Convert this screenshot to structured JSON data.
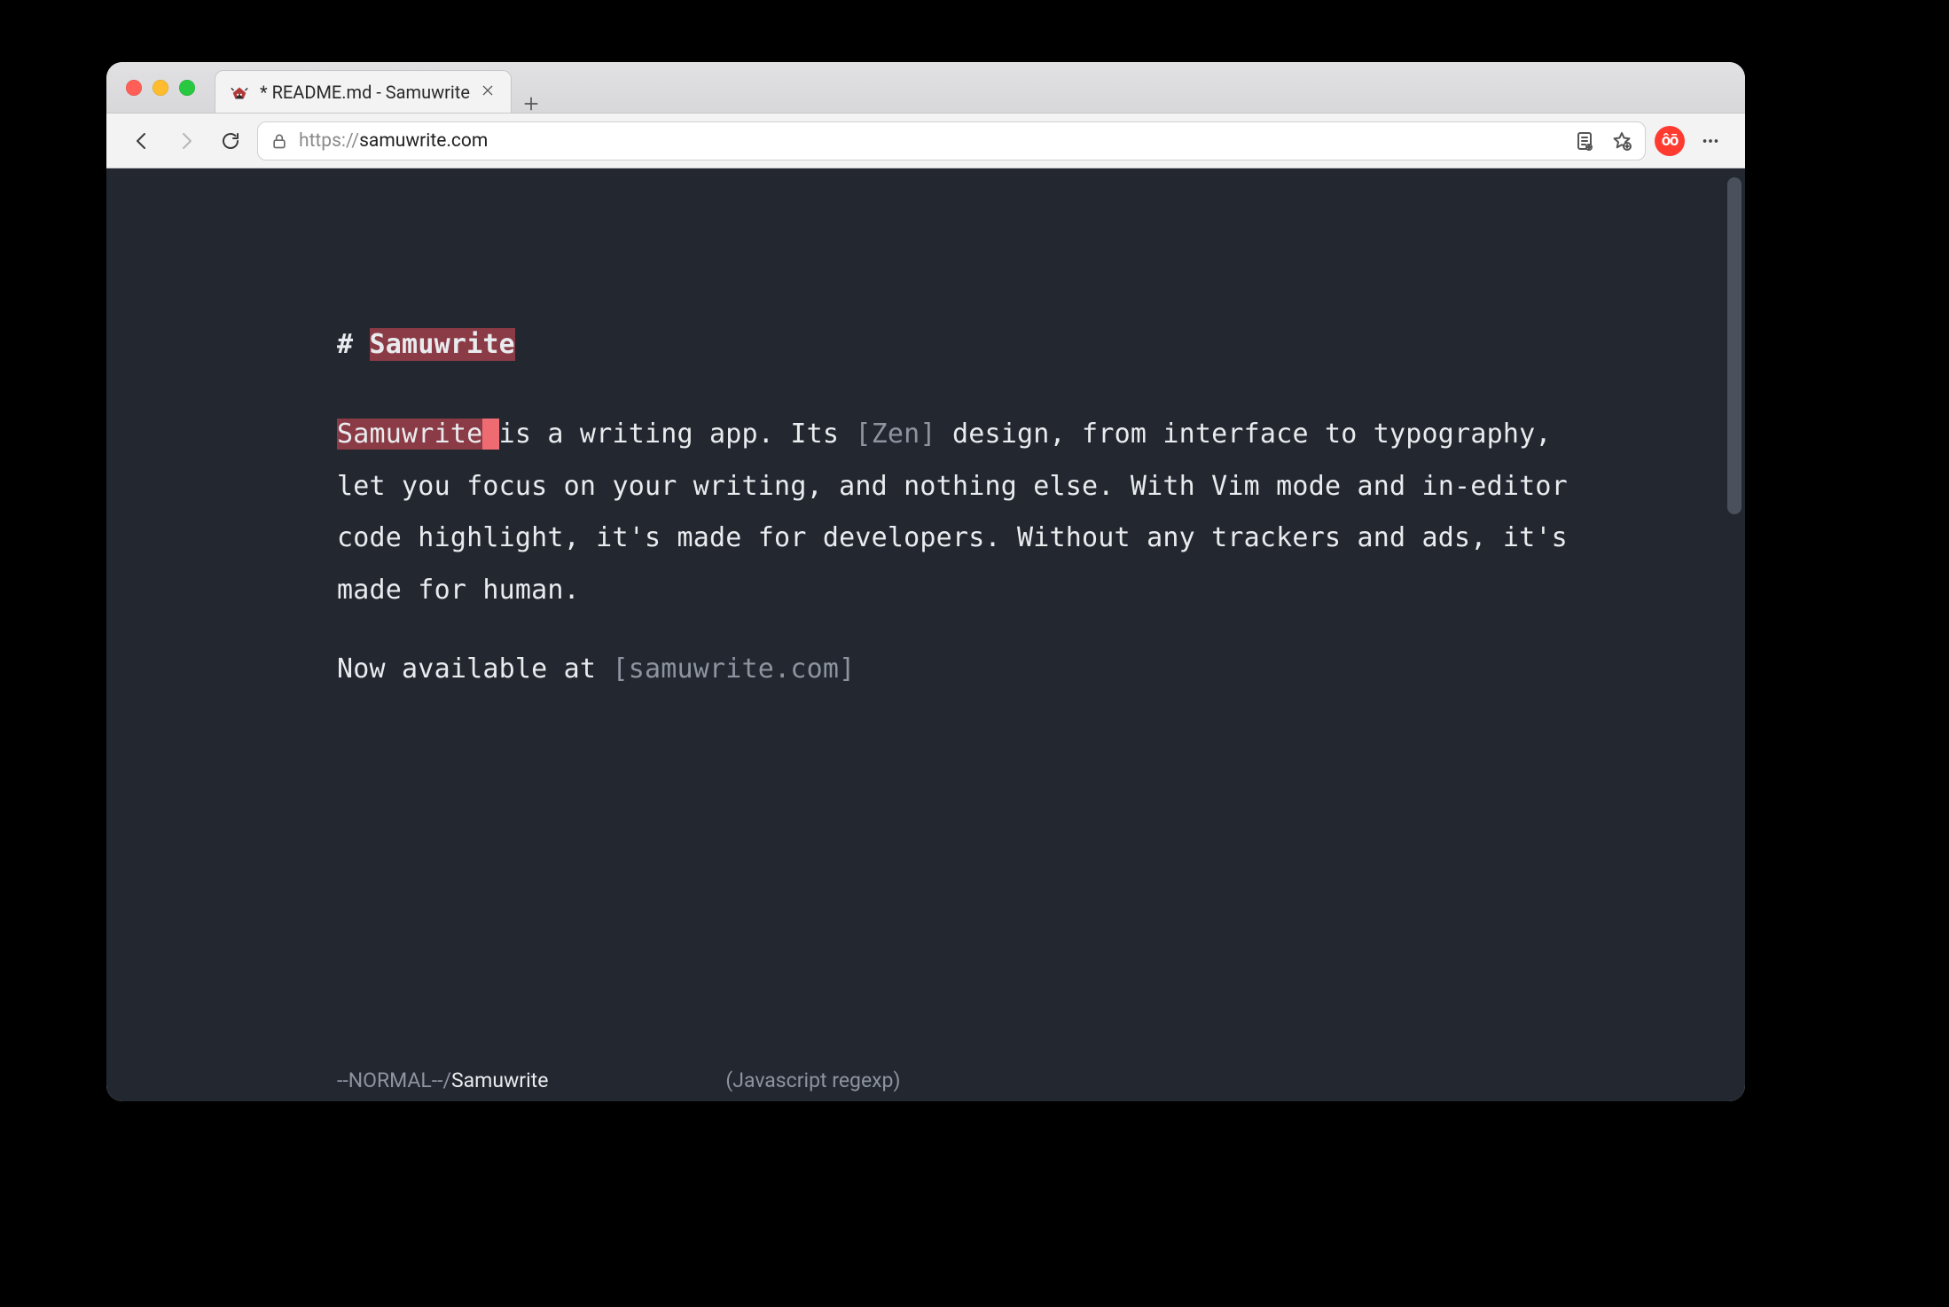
{
  "window": {
    "tab_title": "* README.md - Samuwrite"
  },
  "toolbar": {
    "url_scheme": "https://",
    "url_host": "samuwrite.com"
  },
  "extension": {
    "badge_text": "ôō"
  },
  "editor": {
    "heading_hash": "# ",
    "heading_text": "Samuwrite",
    "p1_match": "Samuwrite",
    "p1_cursor": " ",
    "p1_seg1": "is a writing app. Its ",
    "p1_link1": "[Zen]",
    "p1_seg2": " design, from interface to typography, let you focus on your writing, and nothing else. With Vim mode and in-editor code highlight, it's made for developers. Without any trackers and ads, it's made for human.",
    "p2_seg1": "Now available at ",
    "p2_link1": "[samuwrite.com]"
  },
  "status": {
    "mode": "--NORMAL--/",
    "query": "Samuwrite",
    "variant": "(Javascript regexp)"
  },
  "icons": {
    "close": "close-icon",
    "plus": "plus-icon",
    "back": "arrow-left-icon",
    "forward": "arrow-right-icon",
    "refresh": "refresh-icon",
    "lock": "lock-icon",
    "reader": "reader-icon",
    "bookmark": "bookmark-star-icon",
    "ext": "extension-badge-icon",
    "overflow": "overflow-menu-icon",
    "favicon": "samurai-favicon"
  }
}
